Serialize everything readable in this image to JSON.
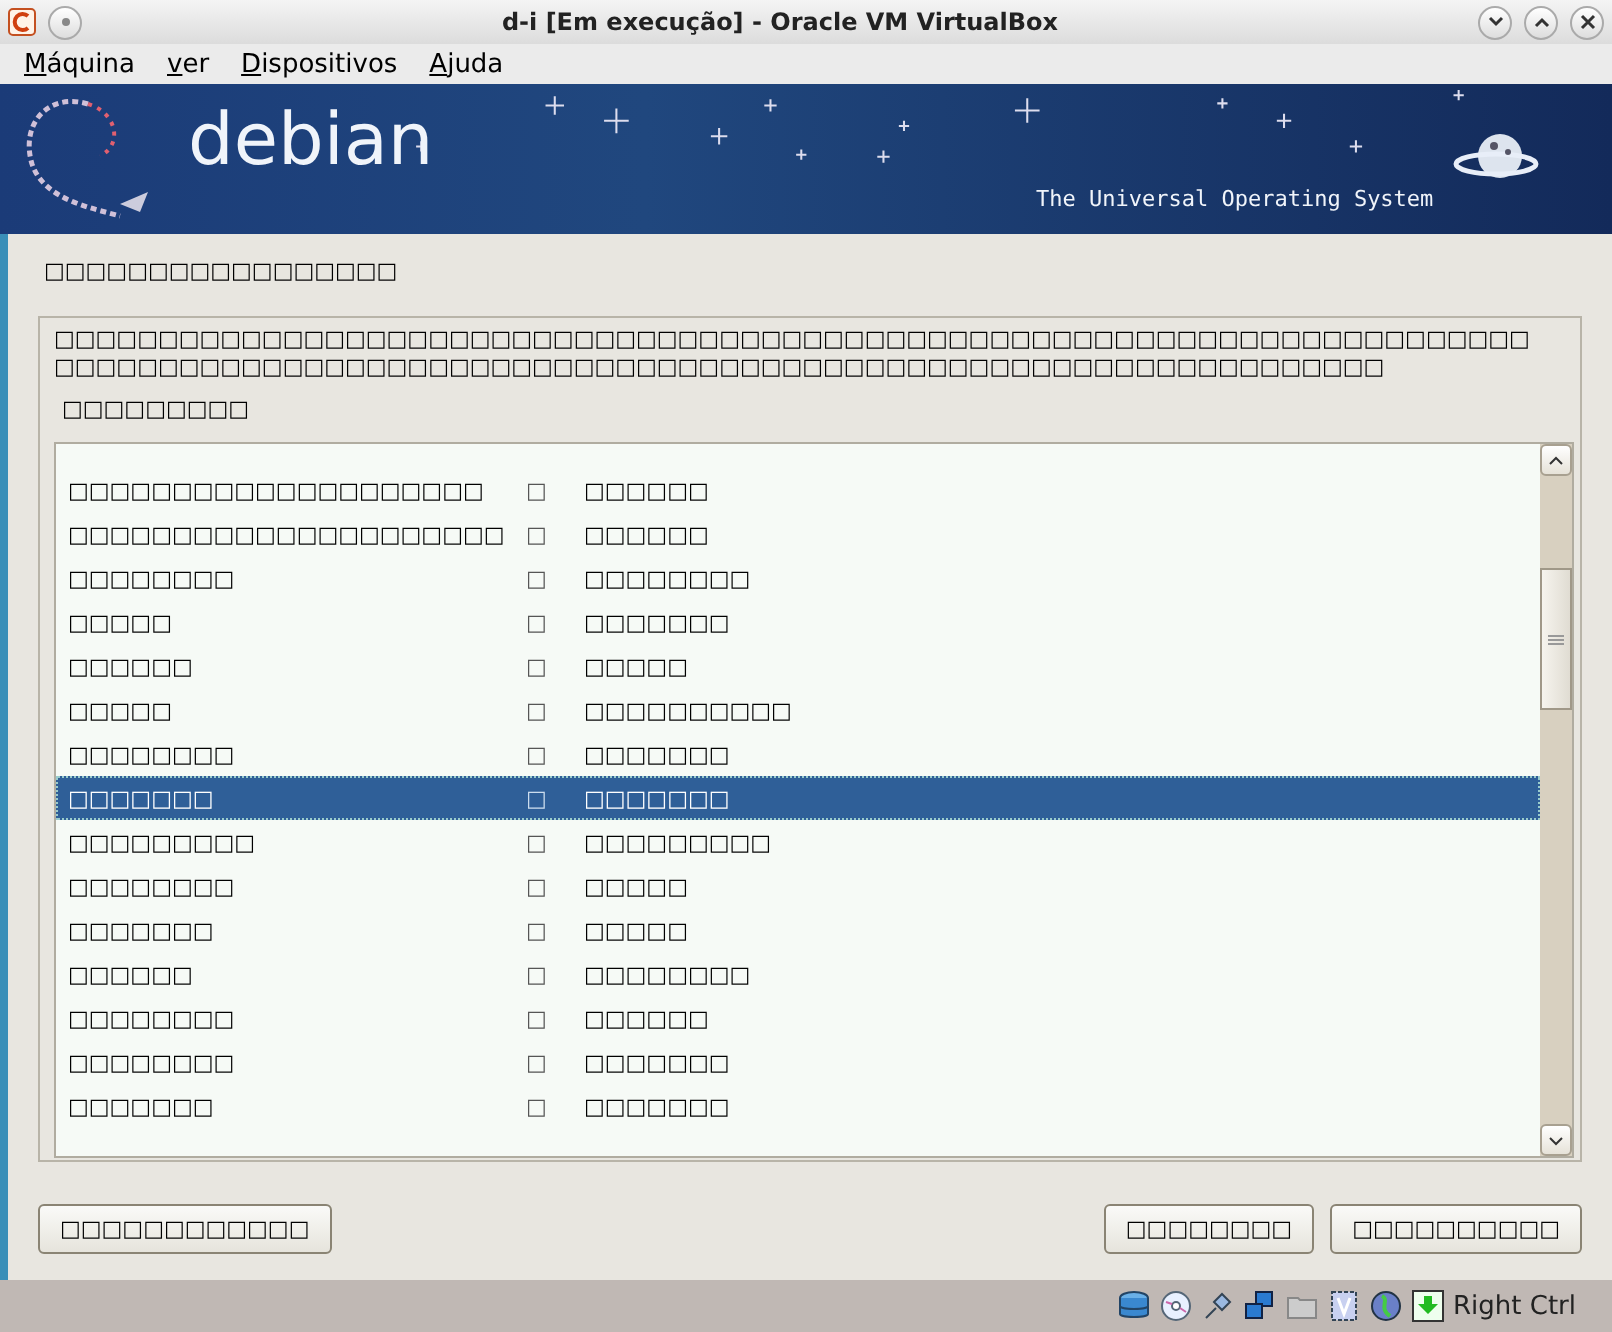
{
  "window": {
    "title": "d-i [Em execução] - Oracle VM VirtualBox"
  },
  "menu": [
    {
      "label": "Máquina"
    },
    {
      "label": "ver"
    },
    {
      "label": "Dispositivos"
    },
    {
      "label": "Ajuda"
    }
  ],
  "banner": {
    "logo_text": "debian",
    "tagline": "The Universal Operating System"
  },
  "installer": {
    "title": "□□□□□□□□□□□□□□□□□",
    "description": "□□□□□□□□□□□□□□□□□□□□□□□□□□□□□□□□□□□□□□□□□□□□□□□□□□□□□□□□□□□□□□□□□□□□□□□□□□□□□□□□□□□□□□□□□□□□□□□□□□□□□□□□□□□□□□□□□□□□□□□□□□□□□□□□□□□□□□□",
    "prompt": "□□□□□□□□□",
    "rows": [
      {
        "name": "□□□□□□□□□□□□□□□□□□□□",
        "mark": "□",
        "value": "□□□□□□",
        "selected": false
      },
      {
        "name": "□□□□□□□□□□□□□□□□□□□□□",
        "mark": "□",
        "value": "□□□□□□",
        "selected": false
      },
      {
        "name": "□□□□□□□□",
        "mark": "□",
        "value": "□□□□□□□□",
        "selected": false
      },
      {
        "name": "□□□□□",
        "mark": "□",
        "value": "□□□□□□□",
        "selected": false
      },
      {
        "name": "□□□□□□",
        "mark": "□",
        "value": "□□□□□",
        "selected": false
      },
      {
        "name": "□□□□□",
        "mark": "□",
        "value": "□□□□□□□□□□",
        "selected": false
      },
      {
        "name": "□□□□□□□□",
        "mark": "□",
        "value": "□□□□□□□",
        "selected": false
      },
      {
        "name": "□□□□□□□",
        "mark": "□",
        "value": "□□□□□□□",
        "selected": true
      },
      {
        "name": "□□□□□□□□□",
        "mark": "□",
        "value": "□□□□□□□□□",
        "selected": false
      },
      {
        "name": "□□□□□□□□",
        "mark": "□",
        "value": "□□□□□",
        "selected": false
      },
      {
        "name": "□□□□□□□",
        "mark": "□",
        "value": "□□□□□",
        "selected": false
      },
      {
        "name": "□□□□□□",
        "mark": "□",
        "value": "□□□□□□□□",
        "selected": false
      },
      {
        "name": "□□□□□□□□",
        "mark": "□",
        "value": "□□□□□□",
        "selected": false
      },
      {
        "name": "□□□□□□□□",
        "mark": "□",
        "value": "□□□□□□□",
        "selected": false
      },
      {
        "name": "□□□□□□□",
        "mark": "□",
        "value": "□□□□□□□",
        "selected": false
      }
    ],
    "buttons": [
      {
        "kind": "back",
        "label": "□□□□□□□□□□□□"
      },
      {
        "kind": "forward",
        "label": "□□□□□□□□"
      },
      {
        "kind": "forward",
        "label": "□□□□□□□□□□"
      }
    ]
  },
  "status_bar": {
    "hotkey": "Right Ctrl"
  }
}
